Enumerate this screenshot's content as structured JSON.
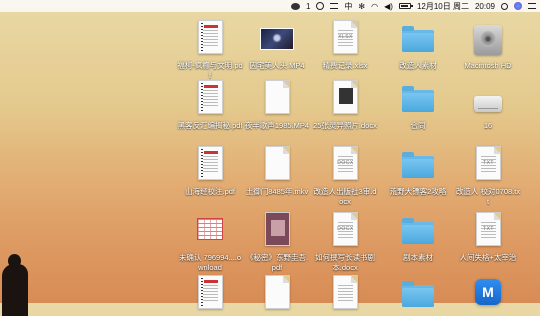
{
  "menubar": {
    "battery_number": "1",
    "input_method": "中",
    "date": "12月10日 周二",
    "time": "20:09"
  },
  "icons": [
    {
      "label": "福柯-疯癫与文明.pdf",
      "type": "pdf"
    },
    {
      "label": "囚宅美人头.MP4",
      "type": "video"
    },
    {
      "label": "精费记录.xlsx",
      "type": "xlsx",
      "tag": "XLSX"
    },
    {
      "label": "改造人素材",
      "type": "folder"
    },
    {
      "label": "Macintosh HD",
      "type": "disk"
    },
    {
      "label": "黑客反汇编揭秘.pdf",
      "type": "pdf"
    },
    {
      "label": "夜半歌声1985.MP4",
      "type": "blank"
    },
    {
      "label": "25张灵异照片.docx",
      "type": "docx-pic"
    },
    {
      "label": "合同",
      "type": "folder"
    },
    {
      "label": "16",
      "type": "drive"
    },
    {
      "label": "山海经校注.pdf",
      "type": "pdf"
    },
    {
      "label": "土御门8485年.mkv",
      "type": "blank"
    },
    {
      "label": "改造人出版社3审.docx",
      "type": "docx",
      "tag": "DOCX"
    },
    {
      "label": "荒野大镖客2攻略",
      "type": "folder"
    },
    {
      "label": "改造人 校对0708.txt",
      "type": "txt",
      "tag": "TXT"
    },
    {
      "label": "未确认 796994....ownload",
      "type": "sheet"
    },
    {
      "label": "《秘密》东野圭吾.pdf",
      "type": "pdf-book"
    },
    {
      "label": "如何撰写长读书剧本.docx",
      "type": "docx",
      "tag": "DOCX"
    },
    {
      "label": "剧本素材",
      "type": "folder"
    },
    {
      "label": "人间失格+太宰治",
      "type": "txt",
      "tag": "TXT"
    },
    {
      "label": "",
      "type": "pdf"
    },
    {
      "label": "",
      "type": "blank"
    },
    {
      "label": "",
      "type": "docx",
      "tag": ""
    },
    {
      "label": "",
      "type": "folder"
    },
    {
      "label": "",
      "type": "app",
      "glyph": "M"
    }
  ]
}
